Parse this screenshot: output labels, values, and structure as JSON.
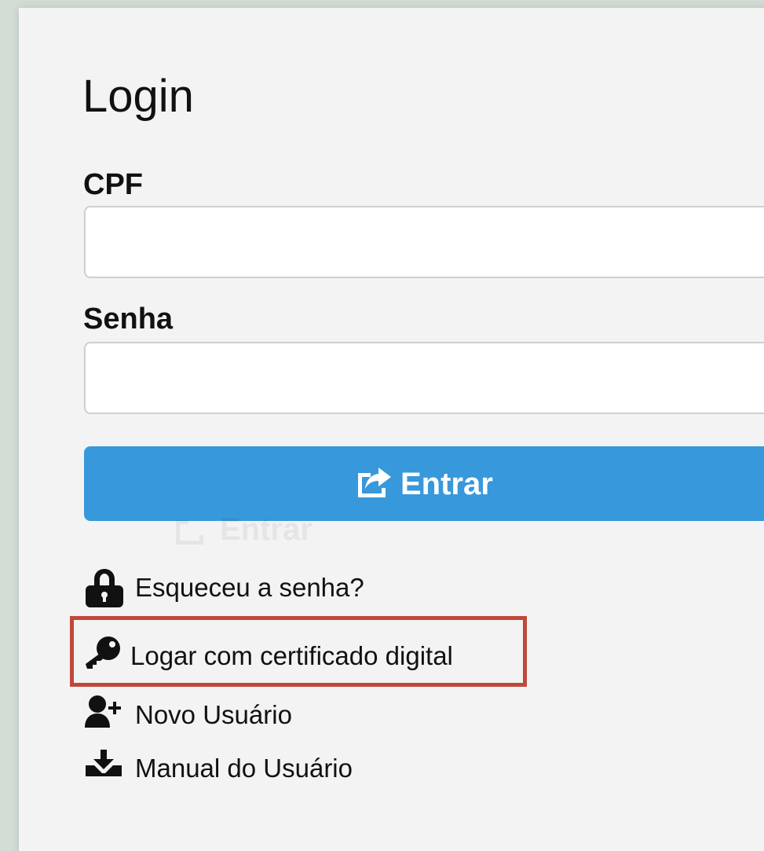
{
  "page": {
    "title": "Login"
  },
  "form": {
    "cpf_label": "CPF",
    "cpf_value": "",
    "senha_label": "Senha",
    "senha_value": "",
    "submit_label": "Entrar",
    "submit_icon": "share-square-icon"
  },
  "links": [
    {
      "label": "Esqueceu a senha?",
      "icon": "lock-icon"
    },
    {
      "label": "Logar com certificado digital",
      "icon": "key-icon"
    },
    {
      "label": "Novo Usuário",
      "icon": "user-plus-icon"
    },
    {
      "label": "Manual do Usuário",
      "icon": "download-icon"
    }
  ],
  "colors": {
    "primary_button": "#3798dc",
    "highlight_border": "#c0483a",
    "background": "#d3ddd5",
    "card": "#f3f3f3"
  }
}
